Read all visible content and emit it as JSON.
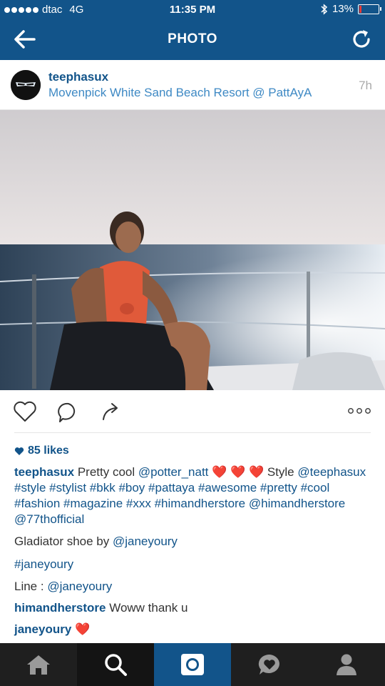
{
  "status_bar": {
    "carrier": "dtac",
    "network": "4G",
    "time": "11:35 PM",
    "battery": "13%",
    "battery_level": 0.13
  },
  "nav": {
    "title": "PHOTO",
    "back_icon": "arrow-left-icon",
    "refresh_icon": "refresh-icon"
  },
  "post": {
    "username": "teephasux",
    "location": "Movenpick White Sand Beach Resort @ PattAyA",
    "time_ago": "7h",
    "likes": "85 likes"
  },
  "caption": {
    "username": "teephasux",
    "text1": " Pretty cool ",
    "mention1": "@potter_natt",
    "text2": " Style",
    "tags": "@teephasux #style #stylist #bkk #boy #pattaya #awesome #pretty #cool #fashion #magazine #xxx #himandherstore @himandherstore @77thofficial"
  },
  "comments": [
    {
      "prefix": "Gladiator shoe by ",
      "mention": "@janeyoury"
    },
    {
      "prefix": "",
      "mention": "#janeyoury"
    },
    {
      "prefix": "Line : ",
      "mention": "@janeyoury"
    },
    {
      "user": "himandherstore",
      "text": " Woww thank u"
    },
    {
      "user": "janeyoury",
      "text": ""
    }
  ],
  "tabs": [
    {
      "name": "home",
      "icon": "home-icon"
    },
    {
      "name": "search",
      "icon": "search-icon"
    },
    {
      "name": "camera",
      "icon": "camera-icon"
    },
    {
      "name": "activity",
      "icon": "heart-bubble-icon"
    },
    {
      "name": "profile",
      "icon": "person-icon"
    }
  ],
  "colors": {
    "brand": "#12548a",
    "link": "#3e89c4",
    "heart": "#e02020"
  }
}
